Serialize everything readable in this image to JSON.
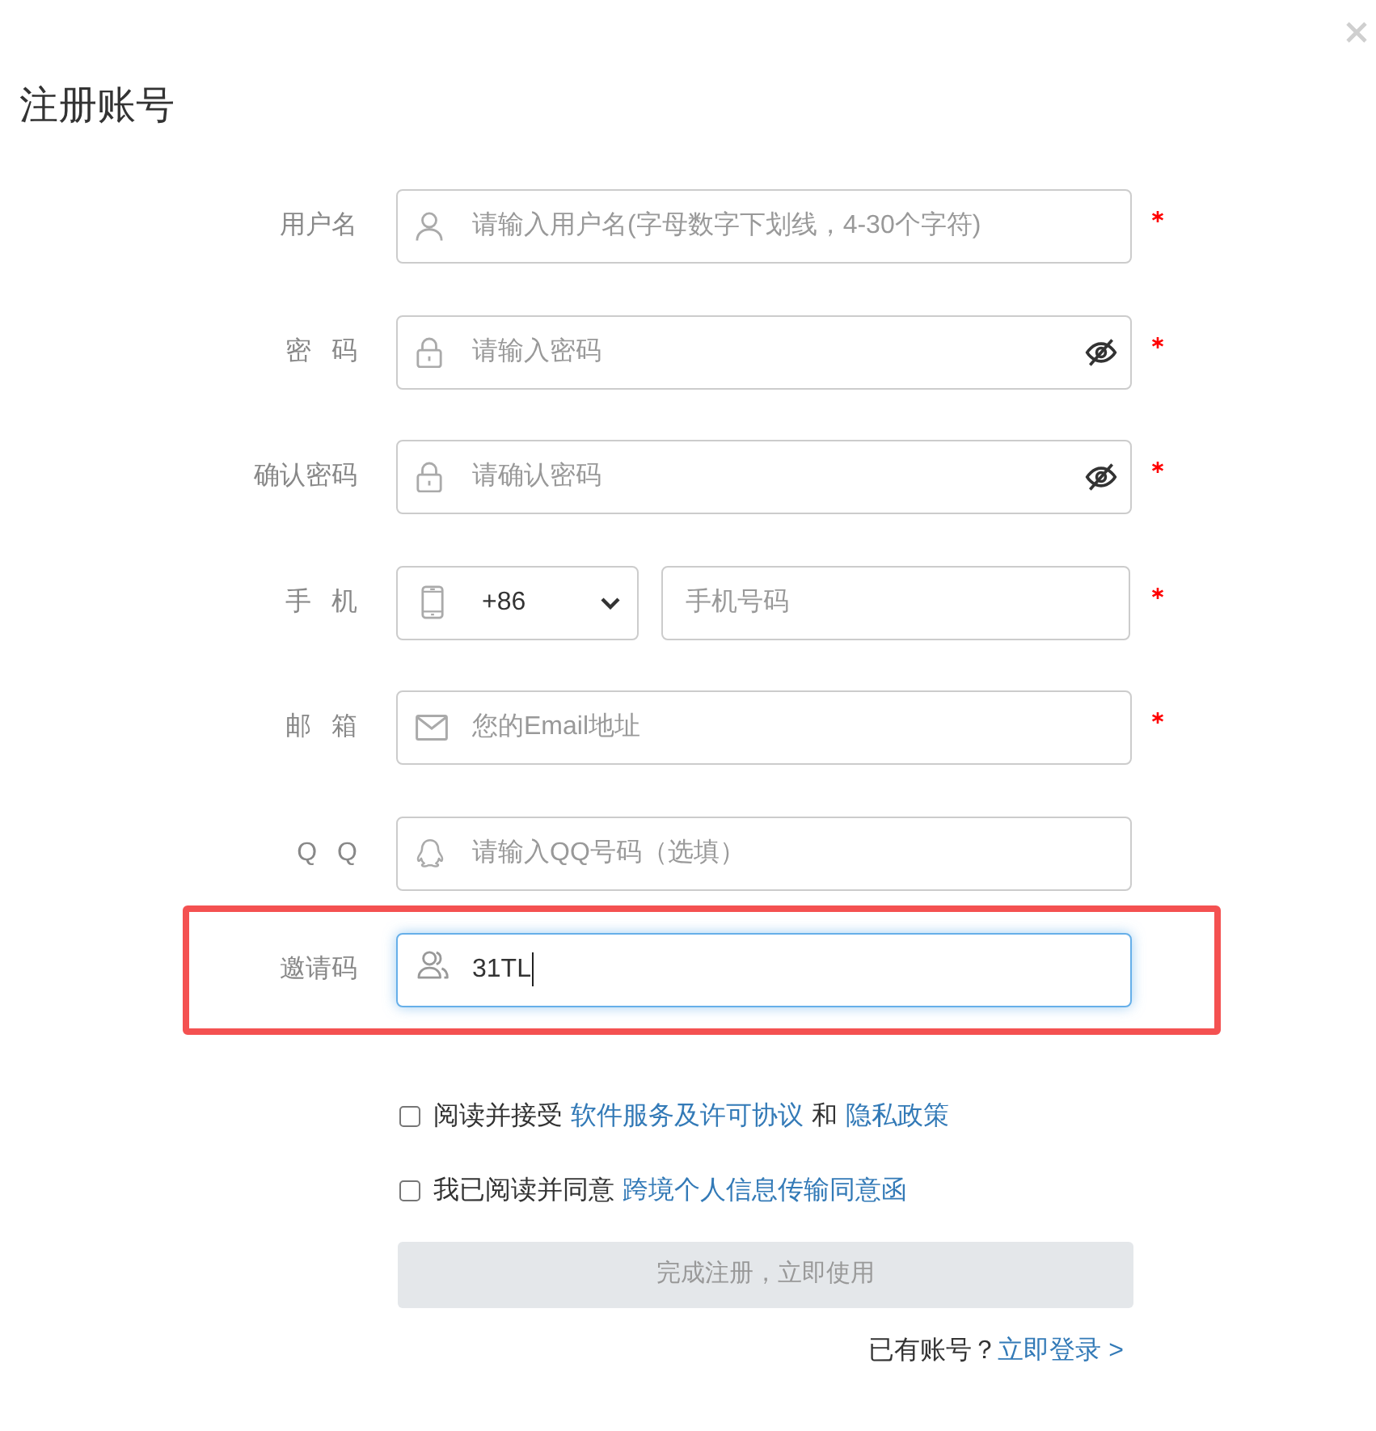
{
  "dialog": {
    "title": "注册账号"
  },
  "fields": [
    {
      "kind": "username",
      "label": "用户名",
      "placeholder": "请输入用户名(字母数字下划线，4-30个字符)",
      "required": true
    },
    {
      "kind": "password",
      "label": "密 码",
      "placeholder": "请输入密码",
      "required": true,
      "show_password": false
    },
    {
      "kind": "password",
      "label": "确认密码",
      "placeholder": "请确认密码",
      "required": true,
      "show_password": false
    },
    {
      "kind": "phone",
      "label": "手 机",
      "country_code": "+86",
      "placeholder": "手机号码",
      "required": true
    },
    {
      "kind": "email",
      "label": "邮 箱",
      "placeholder": "您的Email地址",
      "required": true
    },
    {
      "kind": "qq",
      "label": "Q Q",
      "placeholder": "请输入QQ号码（选填）",
      "required": false
    },
    {
      "kind": "invite",
      "label": "邀请码",
      "value": "31TL",
      "required": false,
      "focused": true,
      "highlighted": true
    }
  ],
  "agreements": [
    {
      "checked": false,
      "parts": [
        {
          "kind": "text",
          "text": "阅读并接受"
        },
        {
          "kind": "link",
          "text": "软件服务及许可协议"
        },
        {
          "kind": "text",
          "text": "和"
        },
        {
          "kind": "link",
          "text": "隐私政策"
        }
      ]
    },
    {
      "checked": false,
      "parts": [
        {
          "kind": "text",
          "text": "我已阅读并同意"
        },
        {
          "kind": "link",
          "text": "跨境个人信息传输同意函"
        }
      ]
    }
  ],
  "submit": {
    "label": "完成注册，立即使用",
    "disabled": true
  },
  "login_prompt": {
    "text": "已有账号？",
    "link": "立即登录 >"
  }
}
